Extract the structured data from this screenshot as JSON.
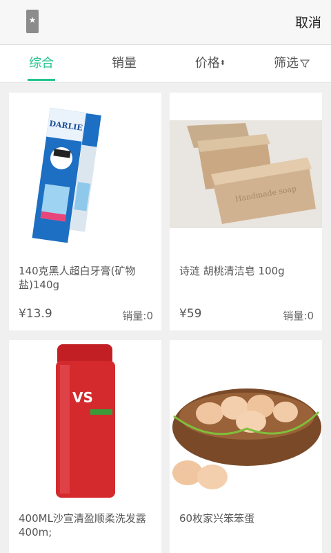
{
  "header": {
    "search_icon_char": "★",
    "cancel_label": "取消"
  },
  "tabs": [
    {
      "label": "综合",
      "active": true
    },
    {
      "label": "销量"
    },
    {
      "label": "价格"
    },
    {
      "label": "筛选"
    }
  ],
  "products": [
    {
      "title": "140克黑人超白牙膏(矿物盐)140g",
      "price": "¥13.9",
      "sales": "销量:0",
      "image": "toothpaste"
    },
    {
      "title": "诗涟 胡桃清洁皂 100g",
      "price": "¥59",
      "sales": "销量:0",
      "image": "soap"
    },
    {
      "title": "400ML沙宣清盈顺柔洗发露400m;",
      "price": "",
      "sales": "",
      "image": "shampoo"
    },
    {
      "title": "60枚家兴笨笨蛋",
      "price": "",
      "sales": "",
      "image": "eggs"
    }
  ],
  "image_text": {
    "toothpaste_brand": "DARLIE",
    "soap_stamp": "Handmade soap",
    "shampoo_brand": "VS"
  },
  "colors": {
    "accent": "#22c38e"
  }
}
